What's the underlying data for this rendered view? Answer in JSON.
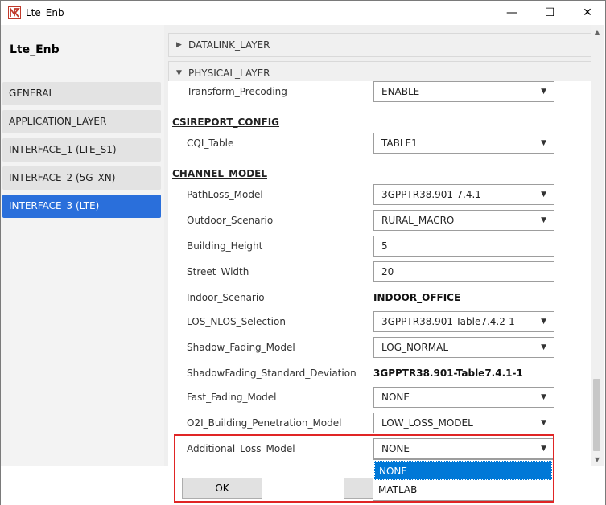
{
  "window": {
    "title": "Lte_Enb",
    "controls": {
      "minimize": "—",
      "maximize": "☐",
      "close": "✕"
    },
    "logo_icon": "netsim-logo-icon"
  },
  "sidebar": {
    "device_title": "Lte_Enb",
    "items": [
      {
        "label": "GENERAL",
        "active": false
      },
      {
        "label": "APPLICATION_LAYER",
        "active": false
      },
      {
        "label": "INTERFACE_1 (LTE_S1)",
        "active": false
      },
      {
        "label": "INTERFACE_2 (5G_XN)",
        "active": false
      },
      {
        "label": "INTERFACE_3 (LTE)",
        "active": true
      }
    ]
  },
  "sections": {
    "datalink": {
      "label": "DATALINK_LAYER",
      "expanded": false
    },
    "physical": {
      "label": "PHYSICAL_LAYER",
      "expanded": true
    }
  },
  "fields": {
    "transform_precoding": {
      "label": "Transform_Precoding",
      "value": "ENABLE"
    },
    "csireport_group": "CSIREPORT_CONFIG",
    "cqi_table": {
      "label": "CQI_Table",
      "value": "TABLE1"
    },
    "channel_group": "CHANNEL_MODEL",
    "pathloss_model": {
      "label": "PathLoss_Model",
      "value": "3GPPTR38.901-7.4.1"
    },
    "outdoor_scenario": {
      "label": "Outdoor_Scenario",
      "value": "RURAL_MACRO"
    },
    "building_height": {
      "label": "Building_Height",
      "value": "5"
    },
    "street_width": {
      "label": "Street_Width",
      "value": "20"
    },
    "indoor_scenario": {
      "label": "Indoor_Scenario",
      "value": "INDOOR_OFFICE"
    },
    "los_nlos": {
      "label": "LOS_NLOS_Selection",
      "value": "3GPPTR38.901-Table7.4.2-1"
    },
    "shadow_fading_model": {
      "label": "Shadow_Fading_Model",
      "value": "LOG_NORMAL"
    },
    "shadow_std_dev": {
      "label": "ShadowFading_Standard_Deviation",
      "value": "3GPPTR38.901-Table7.4.1-1"
    },
    "fast_fading_model": {
      "label": "Fast_Fading_Model",
      "value": "NONE"
    },
    "o2i_penetration": {
      "label": "O2I_Building_Penetration_Model",
      "value": "LOW_LOSS_MODEL"
    },
    "additional_loss": {
      "label": "Additional_Loss_Model",
      "value": "NONE"
    }
  },
  "dropdown": {
    "options": [
      {
        "label": "NONE",
        "highlighted": true
      },
      {
        "label": "MATLAB",
        "highlighted": false
      }
    ]
  },
  "buttons": {
    "ok": "OK",
    "cancel": ""
  },
  "colors": {
    "accent": "#2a6fdb",
    "highlight": "#0078d7",
    "annotation": "#e02525"
  }
}
